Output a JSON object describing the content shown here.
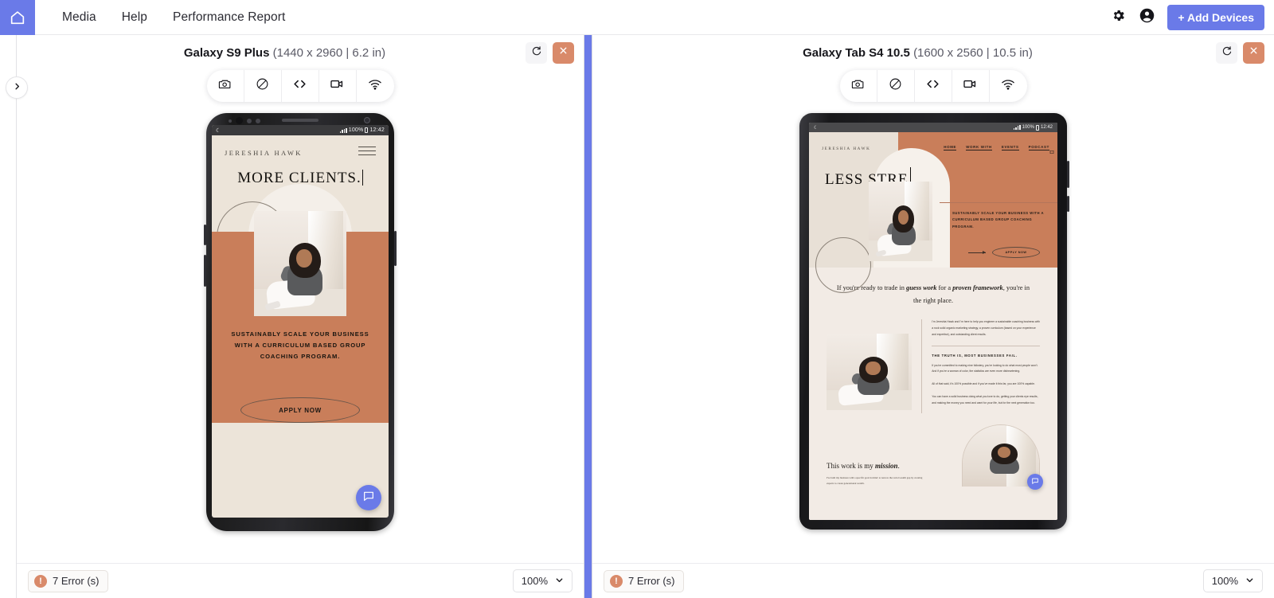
{
  "topbar": {
    "home_icon": "home-icon",
    "links": [
      {
        "label": "Media"
      },
      {
        "label": "Help"
      },
      {
        "label": "Performance Report"
      }
    ],
    "settings_icon": "gear-icon",
    "account_icon": "account-circle-icon",
    "add_devices_label": "+ Add Devices",
    "accent_color": "#6a7ae8"
  },
  "sidebar": {
    "expand_icon": "chevron-right-icon",
    "collapsed": true
  },
  "device_toolbar": {
    "items": [
      {
        "icon": "camera-icon",
        "name": "screenshot"
      },
      {
        "icon": "rotate-screen-icon",
        "name": "rotate"
      },
      {
        "icon": "code-brackets-icon",
        "name": "dev-tools"
      },
      {
        "icon": "video-camera-icon",
        "name": "record"
      },
      {
        "icon": "wifi-icon",
        "name": "network"
      }
    ]
  },
  "panes": [
    {
      "device_name": "Galaxy S9 Plus",
      "device_specs": "(1440 x 2960 | 6.2 in)",
      "refresh_icon": "refresh-icon",
      "close_icon": "close-icon",
      "error_count": "7 Error (s)",
      "error_badge": "!",
      "zoom_level": "100%",
      "zoom_caret_icon": "chevron-down-icon"
    },
    {
      "device_name": "Galaxy Tab S4 10.5",
      "device_specs": "(1600 x 2560 | 10.5 in)",
      "refresh_icon": "refresh-icon",
      "close_icon": "close-icon",
      "error_count": "7 Error (s)",
      "error_badge": "!",
      "zoom_level": "100%",
      "zoom_caret_icon": "chevron-down-icon"
    }
  ],
  "phone_preview": {
    "status_time": "12:42",
    "status_battery": "100%",
    "brand": "JERESHIA HAWK",
    "menu_icon": "hamburger-menu-icon",
    "headline": "MORE  CLIENTS.",
    "cta_text": "SUSTAINABLY SCALE YOUR BUSINESS WITH A CURRICULUM BASED GROUP COACHING PROGRAM.",
    "cta_button": "APPLY NOW",
    "chat_icon": "chat-bubble-icon"
  },
  "tablet_preview": {
    "status_time": "12:42",
    "status_battery": "100%",
    "brand": "JERESHIA HAWK",
    "nav": [
      {
        "label": "HOME"
      },
      {
        "label": "WORK WITH"
      },
      {
        "label": "EVENTS"
      },
      {
        "label": "PODCAST"
      }
    ],
    "cart_icon": "cart-icon",
    "headline": "LESS  STRE",
    "sub_text": "SUSTAINABLY SCALE YOUR BUSINESS WITH A CURRICULUM BASED GROUP COACHING PROGRAM.",
    "apply_button": "APPLY NOW",
    "quote_pre": "If you're ready to trade in ",
    "quote_em1": "guess work",
    "quote_mid": " for a ",
    "quote_em2": "proven framework",
    "quote_post": ", you're in the right place.",
    "bio_paragraph": "I'm Jereshia Hawk and I'm here to help you engineer a sustainable coaching business with a rock solid organic marketing strategy, a proven curriculum (based on your experience and expertise), and outstanding client results.",
    "section_heading": "THE TRUTH IS, MOST BUSINESSES FAIL.",
    "body_p1": "If you're committed to making nine folkstery, you're looking to do what most people won't. And if you're a woman of color, the statistics are even more disheartening.",
    "body_p2": "All of that said, it's 100% possible and if you've made it this far, you are 100% capable.",
    "body_p3": "You can have a solid business doing what you love to do, getting your clients eye results, and making the money you need and want for your life, but for the next generation too.",
    "mission_pre": "This work is my ",
    "mission_em": "mission",
    "mission_post": ".",
    "mission_paragraph": "I've built my business with a specific goal in mind: to narrow the racial wealth gap by creating experts to create generational wealth.",
    "chat_icon": "chat-bubble-icon"
  },
  "colors": {
    "accent": "#6a7ae8",
    "terracotta": "#c97e5a",
    "error": "#d98a6a",
    "cream": "#ece4d9"
  }
}
